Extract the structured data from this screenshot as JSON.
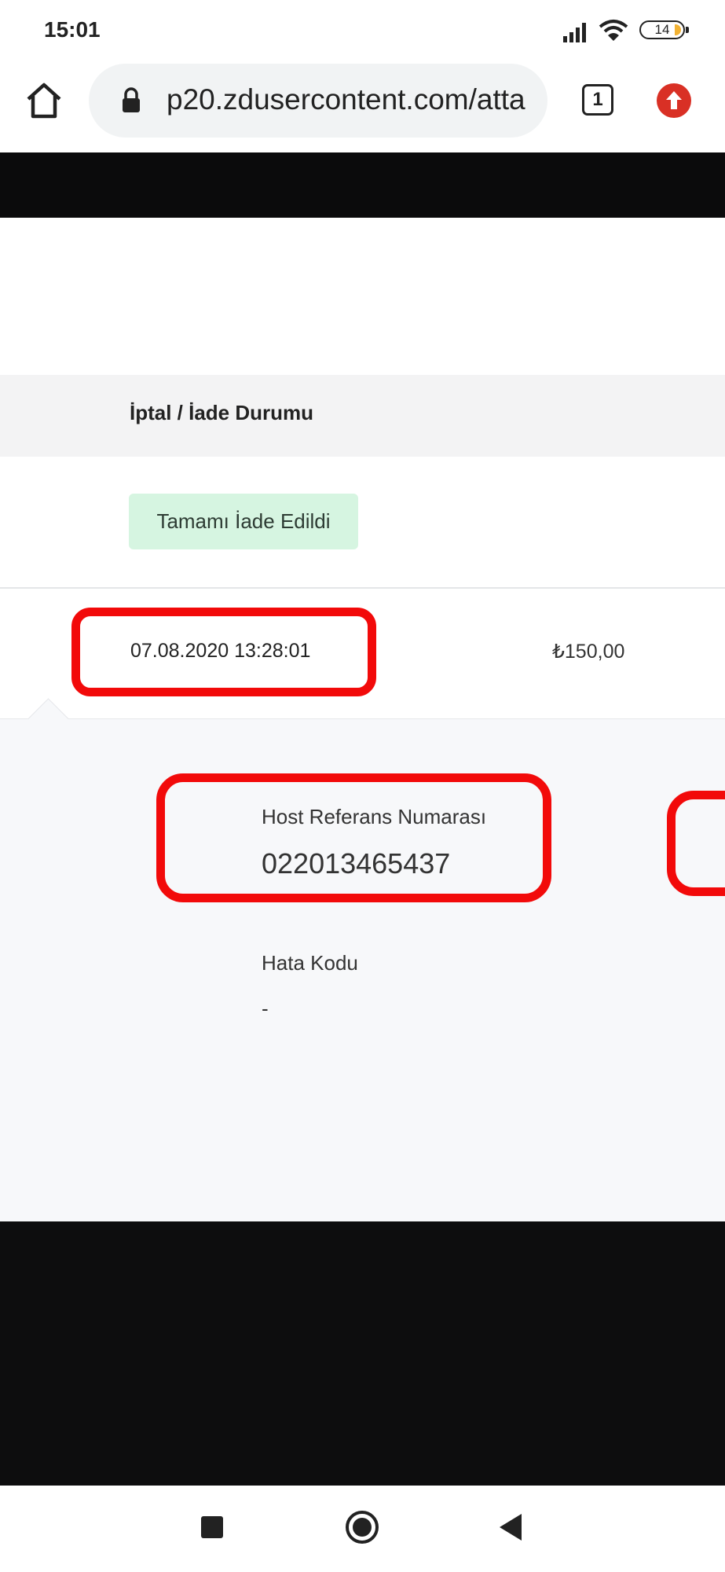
{
  "status_bar": {
    "time": "15:01",
    "battery_level": "14",
    "icons": [
      "signal-icon",
      "wifi-icon",
      "battery-icon"
    ]
  },
  "browser": {
    "url": "p20.zdusercontent.com/atta",
    "tab_count": "1",
    "icons": [
      "home-icon",
      "lock-icon",
      "tabs-icon",
      "update-icon"
    ]
  },
  "table": {
    "header": "İptal / İade Durumu",
    "status_badge": "Tamamı İade Edildi",
    "row": {
      "date": "07.08.2020 13:28:01",
      "amount": "₺150,00"
    }
  },
  "details": {
    "host_ref_label": "Host Referans Numarası",
    "host_ref_value": "022013465437",
    "error_label": "Hata Kodu",
    "error_value": "-"
  },
  "colors": {
    "highlight": "#f20a0a",
    "badge_bg": "#d6f5e1",
    "update_red": "#d93025"
  },
  "navbar": {
    "icons": [
      "recents-icon",
      "home-circle-icon",
      "back-icon"
    ]
  }
}
